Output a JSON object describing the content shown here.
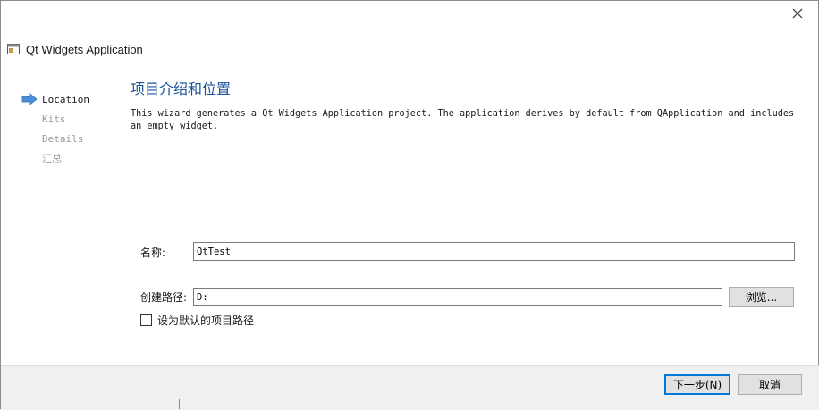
{
  "window": {
    "title": "Qt Widgets Application"
  },
  "sidebar": {
    "items": [
      {
        "label": "Location",
        "active": true
      },
      {
        "label": "Kits",
        "active": false
      },
      {
        "label": "Details",
        "active": false
      },
      {
        "label": "汇总",
        "active": false
      }
    ]
  },
  "page": {
    "title": "项目介绍和位置",
    "description": "This wizard generates a Qt Widgets Application project. The application derives by default from QApplication and includes an empty widget."
  },
  "form": {
    "name_label": "名称:",
    "name_value": "QtTest",
    "path_label": "创建路径:",
    "path_value": "D:",
    "browse_label": "浏览...",
    "default_path_checkbox": {
      "label": "设为默认的项目路径",
      "checked": false
    }
  },
  "footer": {
    "next_label": "下一步(N)",
    "cancel_label": "取消"
  },
  "colors": {
    "title_blue": "#1b4f9a",
    "arrow_blue": "#4a8fd6",
    "focus_blue": "#0078d7",
    "footer_bg": "#f0f0f0"
  },
  "icons": {
    "close": "close-icon",
    "app": "qt-app-window-icon",
    "current_step": "current-step-arrow-icon"
  }
}
